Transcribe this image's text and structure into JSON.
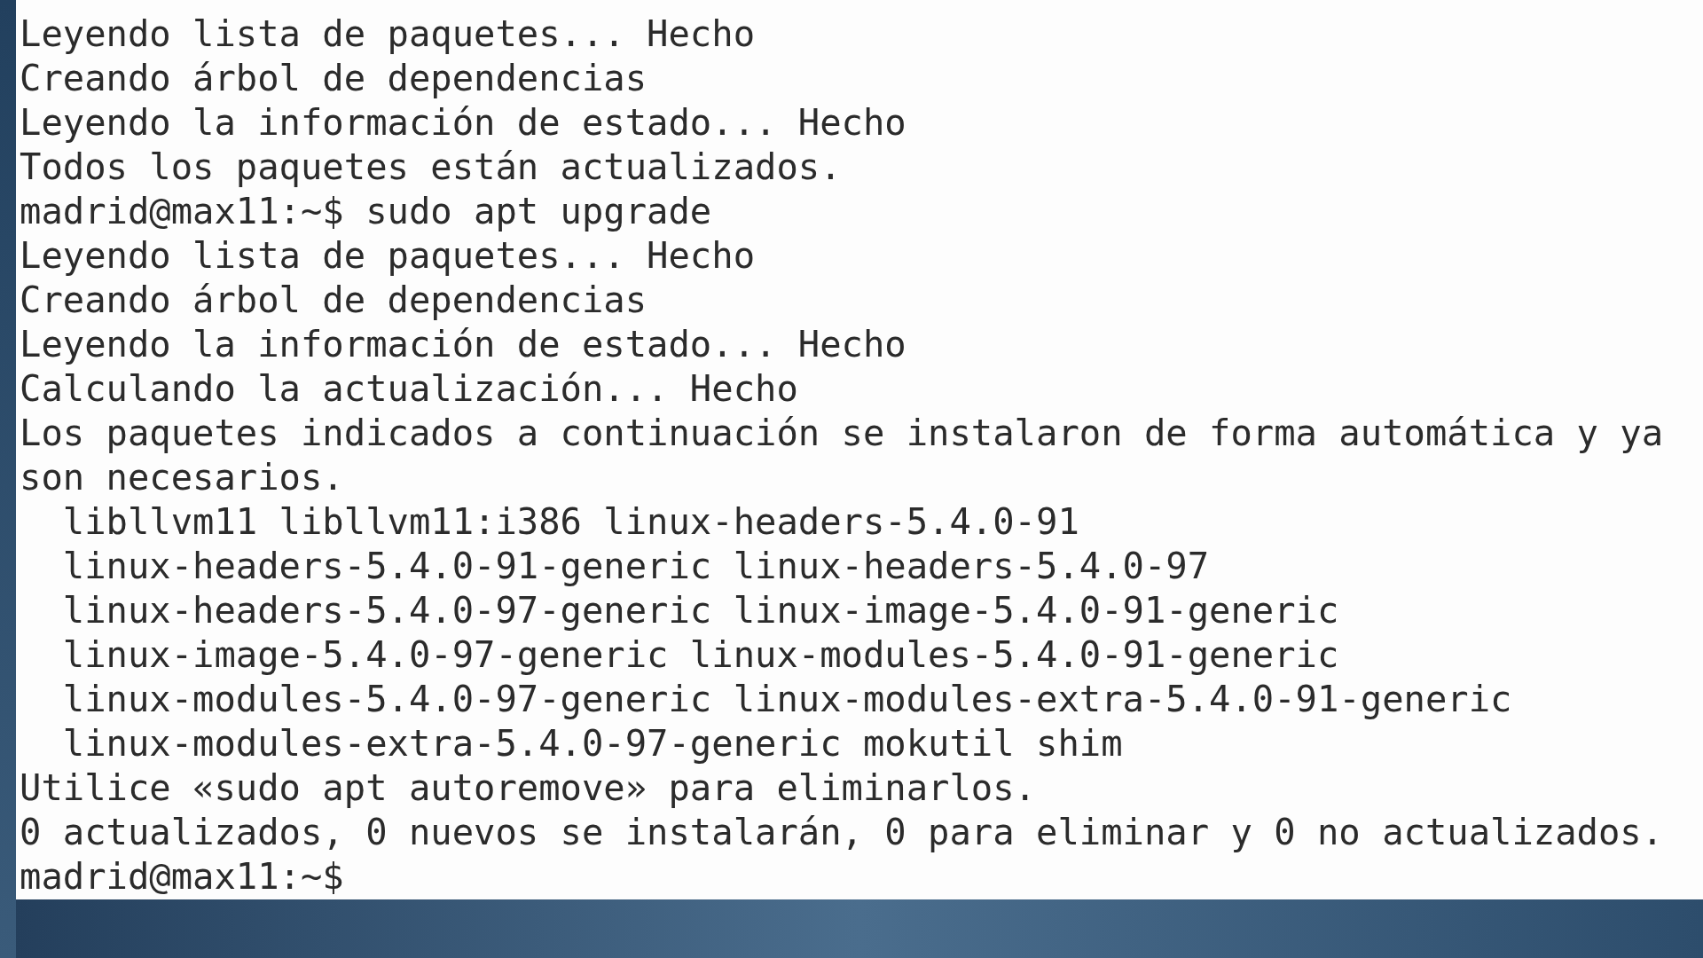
{
  "terminal": {
    "lines": [
      "Leyendo lista de paquetes... Hecho",
      "Creando árbol de dependencias",
      "Leyendo la información de estado... Hecho",
      "Todos los paquetes están actualizados.",
      "madrid@max11:~$ sudo apt upgrade",
      "Leyendo lista de paquetes... Hecho",
      "Creando árbol de dependencias",
      "Leyendo la información de estado... Hecho",
      "Calculando la actualización... Hecho",
      "Los paquetes indicados a continuación se instalaron de forma automática y ya",
      "son necesarios.",
      "  libllvm11 libllvm11:i386 linux-headers-5.4.0-91",
      "  linux-headers-5.4.0-91-generic linux-headers-5.4.0-97",
      "  linux-headers-5.4.0-97-generic linux-image-5.4.0-91-generic",
      "  linux-image-5.4.0-97-generic linux-modules-5.4.0-91-generic",
      "  linux-modules-5.4.0-97-generic linux-modules-extra-5.4.0-91-generic",
      "  linux-modules-extra-5.4.0-97-generic mokutil shim",
      "Utilice «sudo apt autoremove» para eliminarlos.",
      "0 actualizados, 0 nuevos se instalarán, 0 para eliminar y 0 no actualizados.",
      "madrid@max11:~$"
    ]
  }
}
